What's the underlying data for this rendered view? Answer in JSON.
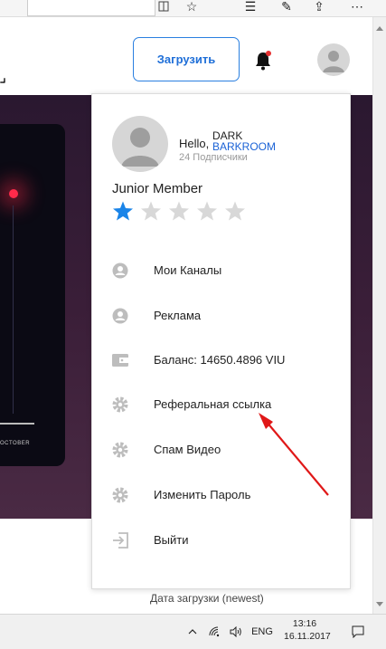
{
  "header": {
    "upload_label": "Загрузить"
  },
  "menu": {
    "hello": "Hello,",
    "username_line1": "DARK",
    "username_line2": "BARKROOM",
    "subscribers": "24 Подписчики",
    "rank": "Junior Member",
    "rating": {
      "value": 1,
      "max": 5
    },
    "items": [
      {
        "label": "Мои Каналы",
        "icon": "user-icon"
      },
      {
        "label": "Реклама",
        "icon": "user-icon"
      },
      {
        "label": "Баланс: 14650.4896 VIU",
        "icon": "wallet-icon"
      },
      {
        "label": "Реферальная ссылка",
        "icon": "gear-icon"
      },
      {
        "label": "Спам Видео",
        "icon": "gear-icon"
      },
      {
        "label": "Изменить Пароль",
        "icon": "gear-icon"
      },
      {
        "label": "Выйти",
        "icon": "logout-icon"
      }
    ]
  },
  "video": {
    "month_label": "OCTOBER"
  },
  "sort": {
    "label": "Дата загрузки (newest)"
  },
  "taskbar": {
    "language": "ENG",
    "time": "13:16",
    "date": "16.11.2017"
  },
  "colors": {
    "accent": "#1f6fd8",
    "star_active": "#1a84e8",
    "star_inactive": "#d8d8d8",
    "annotation_arrow": "#e01818"
  }
}
